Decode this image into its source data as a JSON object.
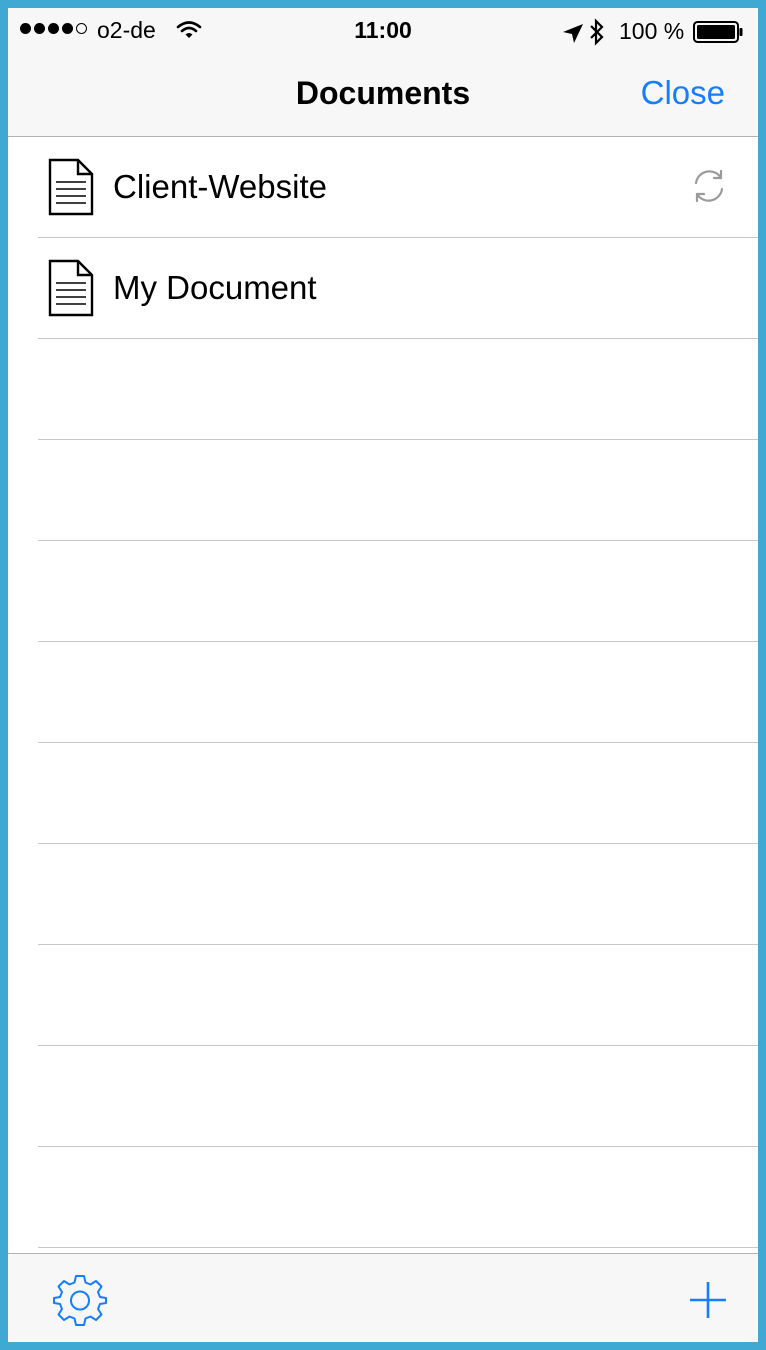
{
  "status_bar": {
    "carrier": "o2-de",
    "time": "11:00",
    "battery": "100 %",
    "signal_bars": 4
  },
  "nav": {
    "title": "Documents",
    "close_label": "Close"
  },
  "documents": [
    {
      "name": "Client-Website",
      "syncing": true
    },
    {
      "name": "My Document",
      "syncing": false
    }
  ],
  "toolbar": {
    "settings_icon": "gear-icon",
    "add_icon": "plus-icon"
  },
  "colors": {
    "accent": "#157efb",
    "frame": "#3fa9d3",
    "separator": "#c8c7cc"
  }
}
